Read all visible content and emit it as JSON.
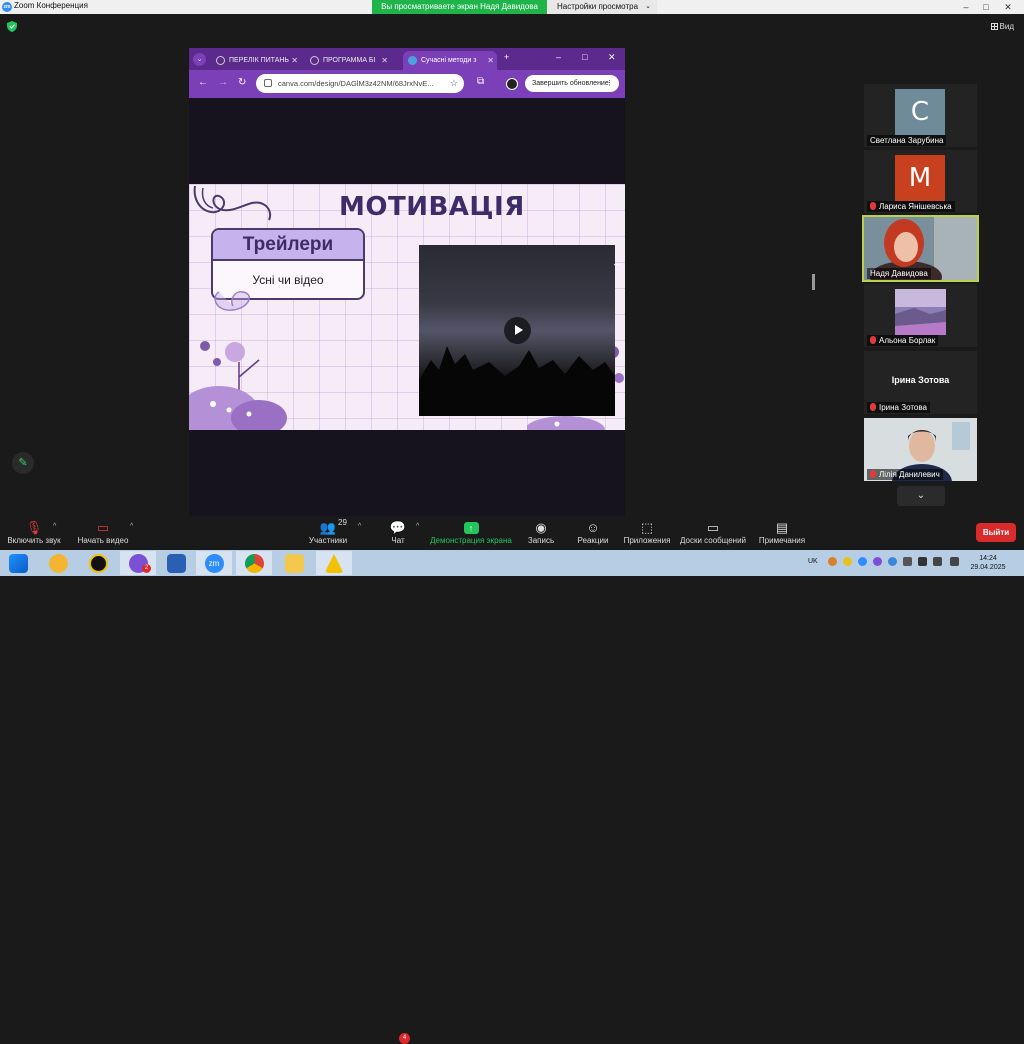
{
  "window": {
    "app_title": "Zoom Конференция",
    "share_banner": "Вы просматриваете экран Надя Давидова",
    "view_options": "Настройки просмотра",
    "view_label": "Вид"
  },
  "browser": {
    "tabs": [
      {
        "label": "ПЕРЕЛІК ПИТАНЬ"
      },
      {
        "label": "ПРОГРАММА БІ"
      },
      {
        "label": "Сучасні методи з"
      }
    ],
    "url": "canva.com/design/DAGlM3z42NM/68JrxNvE...",
    "finish_update": "Завершить обновление"
  },
  "slide": {
    "title": "МОТИВАЦІЯ",
    "card_title": "Трейлери",
    "card_text": "Усні чи відео"
  },
  "participants": [
    {
      "name": "Светлана Зарубина",
      "initial": "С",
      "color": "#6f8a99",
      "muted": false
    },
    {
      "name": "Лариса Янішевська",
      "initial": "М",
      "color": "#c9401e",
      "muted": true
    },
    {
      "name": "Надя Давидова",
      "video": true,
      "speaking": true,
      "muted": false
    },
    {
      "name": "Альона Борлак",
      "video": true,
      "muted": true
    },
    {
      "name": "Ірина Зотова",
      "big_name": "Ірина Зотова",
      "muted": true
    },
    {
      "name": "Лілія Данилевич",
      "video": true,
      "muted": true
    }
  ],
  "controls": {
    "audio": "Включить звук",
    "video": "Начать видео",
    "participants": "Участники",
    "participants_count": "29",
    "chat": "Чат",
    "chat_badge": "4",
    "share": "Демонстрация экрана",
    "record": "Запись",
    "reactions": "Реакции",
    "apps": "Приложения",
    "whiteboards": "Доски сообщений",
    "notes": "Примечания",
    "leave": "Выйти"
  },
  "taskbar": {
    "lang": "UK",
    "time": "14:24",
    "date": "29.04.2025",
    "viber_badge": "2"
  }
}
